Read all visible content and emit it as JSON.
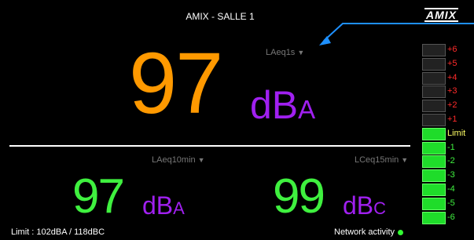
{
  "header": {
    "title": "AMIX -  SALLE 1",
    "logo": "AMIX"
  },
  "main": {
    "selector": "LAeq1s",
    "value": "97",
    "unit": "dB",
    "unit_sub": "A",
    "value_color": "#ff9900",
    "unit_color": "#a020f0"
  },
  "left": {
    "selector": "LAeq10min",
    "value": "97",
    "unit": "dB",
    "unit_sub": "A",
    "value_color": "#3ff03f",
    "unit_color": "#a020f0"
  },
  "right": {
    "selector": "LCeq15min",
    "value": "99",
    "unit": "dB",
    "unit_sub": "C",
    "value_color": "#3ff03f",
    "unit_color": "#a020f0"
  },
  "footer": {
    "limit_text": "Limit : 102dBA / 118dBC",
    "network": "Network activity"
  },
  "meter": {
    "labels": [
      "+6",
      "+5",
      "+4",
      "+3",
      "+2",
      "+1",
      "Limit",
      "-1",
      "-2",
      "-3",
      "-4",
      "-5",
      "-6"
    ],
    "active_from_index": 6,
    "label_colors": {
      "over": "#ff2a2a",
      "limit": "#ffff66",
      "under": "#3ff03f"
    }
  },
  "icons": {
    "dropdown": "triangle-down-icon",
    "status": "green-dot-icon",
    "annotation": "blue-arrow-icon"
  }
}
